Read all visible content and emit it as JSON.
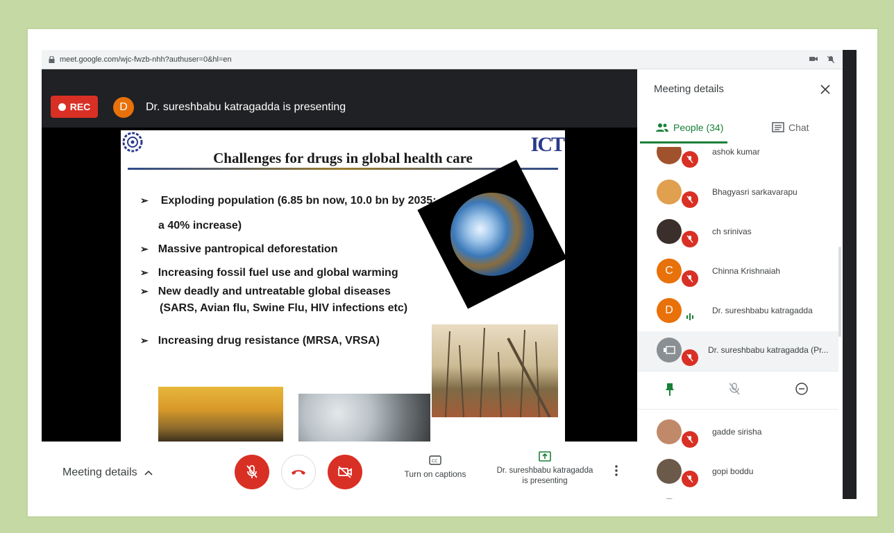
{
  "browser": {
    "url": "meet.google.com/wjc-fwzb-nhh?authuser=0&hl=en"
  },
  "topbar": {
    "rec_label": "REC",
    "presenter_initial": "D",
    "presenter_text": "Dr. sureshbabu katragadda is presenting"
  },
  "slide": {
    "title": "Challenges for drugs in global health care",
    "logo_right": "ICT",
    "bullets": [
      "Exploding population (6.85 bn now, 10.0 bn by 2035;",
      "Massive pantropical deforestation",
      "Increasing fossil fuel use and global warming",
      "New deadly and untreatable global diseases",
      "Increasing drug resistance (MRSA, VRSA)"
    ],
    "continuations": [
      "a 40% increase)",
      "(SARS, Avian flu, Swine Flu, HIV infections etc)"
    ]
  },
  "controls": {
    "meeting_details": "Meeting details",
    "captions": "Turn on captions",
    "presenting_line1": "Dr. sureshbabu katragadda",
    "presenting_line2": "is presenting"
  },
  "side_panel": {
    "title": "Meeting details",
    "tabs": {
      "people": "People (34)",
      "chat": "Chat"
    },
    "people": [
      {
        "name": "ashok kumar",
        "initial": "",
        "color": "#a0522d",
        "muted": true
      },
      {
        "name": "Bhagyasri sarkavarapu",
        "initial": "",
        "color": "#e0a050",
        "muted": true
      },
      {
        "name": "ch srinivas",
        "initial": "",
        "color": "#3a2f2a",
        "muted": true
      },
      {
        "name": "Chinna Krishnaiah",
        "initial": "C",
        "color": "#e8710a",
        "muted": true
      },
      {
        "name": "Dr. sureshbabu katragadda",
        "initial": "D",
        "color": "#e8710a",
        "muted": false
      },
      {
        "name": "Dr. sureshbabu katragadda (Pr...",
        "initial": "",
        "color": "#8a8f93",
        "muted": true
      },
      {
        "name": "gadde sirisha",
        "initial": "",
        "color": "#c08a6a",
        "muted": true
      },
      {
        "name": "gopi boddu",
        "initial": "",
        "color": "#6b5a4a",
        "muted": true
      }
    ]
  },
  "colors": {
    "accent_red": "#d93025",
    "accent_green": "#188038",
    "background": "#c5d9a4"
  }
}
